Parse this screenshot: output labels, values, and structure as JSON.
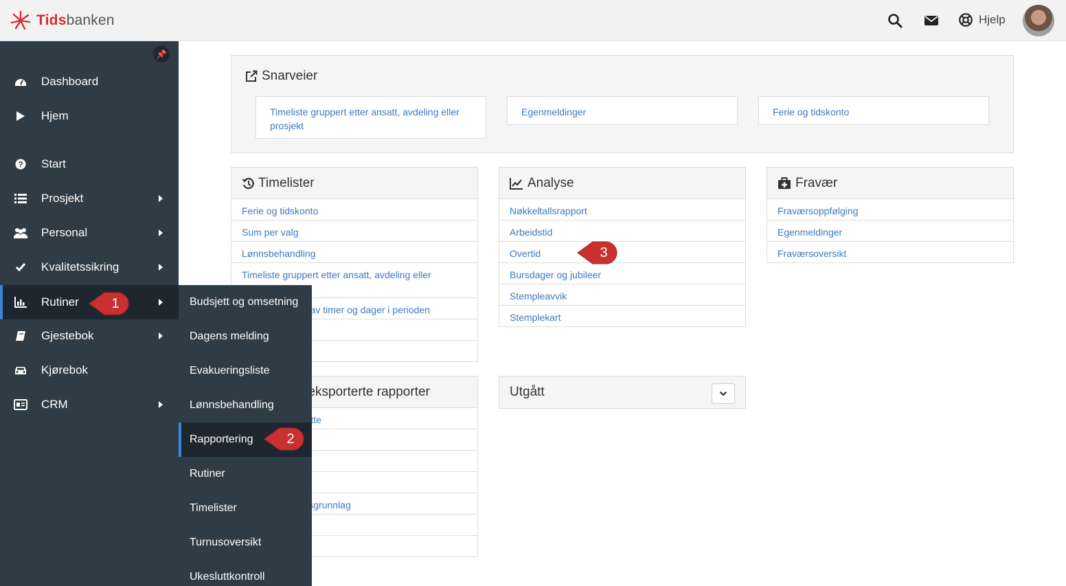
{
  "header": {
    "logo_part1": "Tids",
    "logo_part2": "banken",
    "icons": [
      "search-icon",
      "mail-icon",
      "lifebuoy-icon"
    ],
    "help_label": "Hjelp"
  },
  "sidebar": {
    "items": [
      {
        "label": "Dashboard",
        "icon": "dashboard-icon"
      },
      {
        "label": "Hjem",
        "icon": "play-icon"
      },
      {
        "label": "Start",
        "icon": "question-icon"
      },
      {
        "label": "Prosjekt",
        "icon": "list-icon"
      },
      {
        "label": "Personal",
        "icon": "users-icon"
      },
      {
        "label": "Kvalitetssikring",
        "icon": "check-icon"
      },
      {
        "label": "Rutiner",
        "icon": "bar-chart-icon"
      },
      {
        "label": "Gjestebok",
        "icon": "book-icon"
      },
      {
        "label": "Kjørebok",
        "icon": "car-icon"
      },
      {
        "label": "CRM",
        "icon": "id-card-icon"
      }
    ]
  },
  "submenu": {
    "items": [
      "Budsjett og omsetning",
      "Dagens melding",
      "Evakueringsliste",
      "Lønnsbehandling",
      "Rapportering",
      "Rutiner",
      "Timelister",
      "Turnusoversikt",
      "Ukesluttkontroll"
    ]
  },
  "callouts": [
    "1",
    "2",
    "3"
  ],
  "snarveier": {
    "title": "Snarveier",
    "links": [
      "Timeliste gruppert etter ansatt, avdeling eller prosjekt",
      "Egenmeldinger",
      "Ferie og tidskonto"
    ]
  },
  "timelister": {
    "title": "Timelister",
    "rows": [
      "Ferie og tidskonto",
      "Sum per valg",
      "Lønnsbehandling",
      "Timeliste gruppert etter ansatt, avdeling eller prosjekt",
      "Oppsummering av timer og dager i perioden",
      "",
      ""
    ]
  },
  "analyse": {
    "title": "Analyse",
    "rows": [
      "Nøkkeltallsrapport",
      "Arbeidstid",
      "Overtid",
      "Bursdager og jubileer",
      "Stempleavvik",
      "Stemplekart"
    ]
  },
  "fravaer": {
    "title": "Fravær",
    "rows": [
      "Fraværsoppfølging",
      "Egenmeldinger",
      "Fraværsoversikt"
    ]
  },
  "tilpassede": {
    "title": "Tilpassede/eksporterte rapporter",
    "rows": [
      "Eksport av ansatte",
      "",
      "",
      "",
      "Eksport av lønnsgrunnlag",
      "",
      ""
    ]
  },
  "utgatt": {
    "title": "Utgått"
  },
  "colors": {
    "sidebar_bg": "#2f3b45",
    "active_accent": "#3b86d4",
    "link": "#3b7bbf",
    "callout": "#c8312f",
    "brand_red": "#d32f2f"
  }
}
